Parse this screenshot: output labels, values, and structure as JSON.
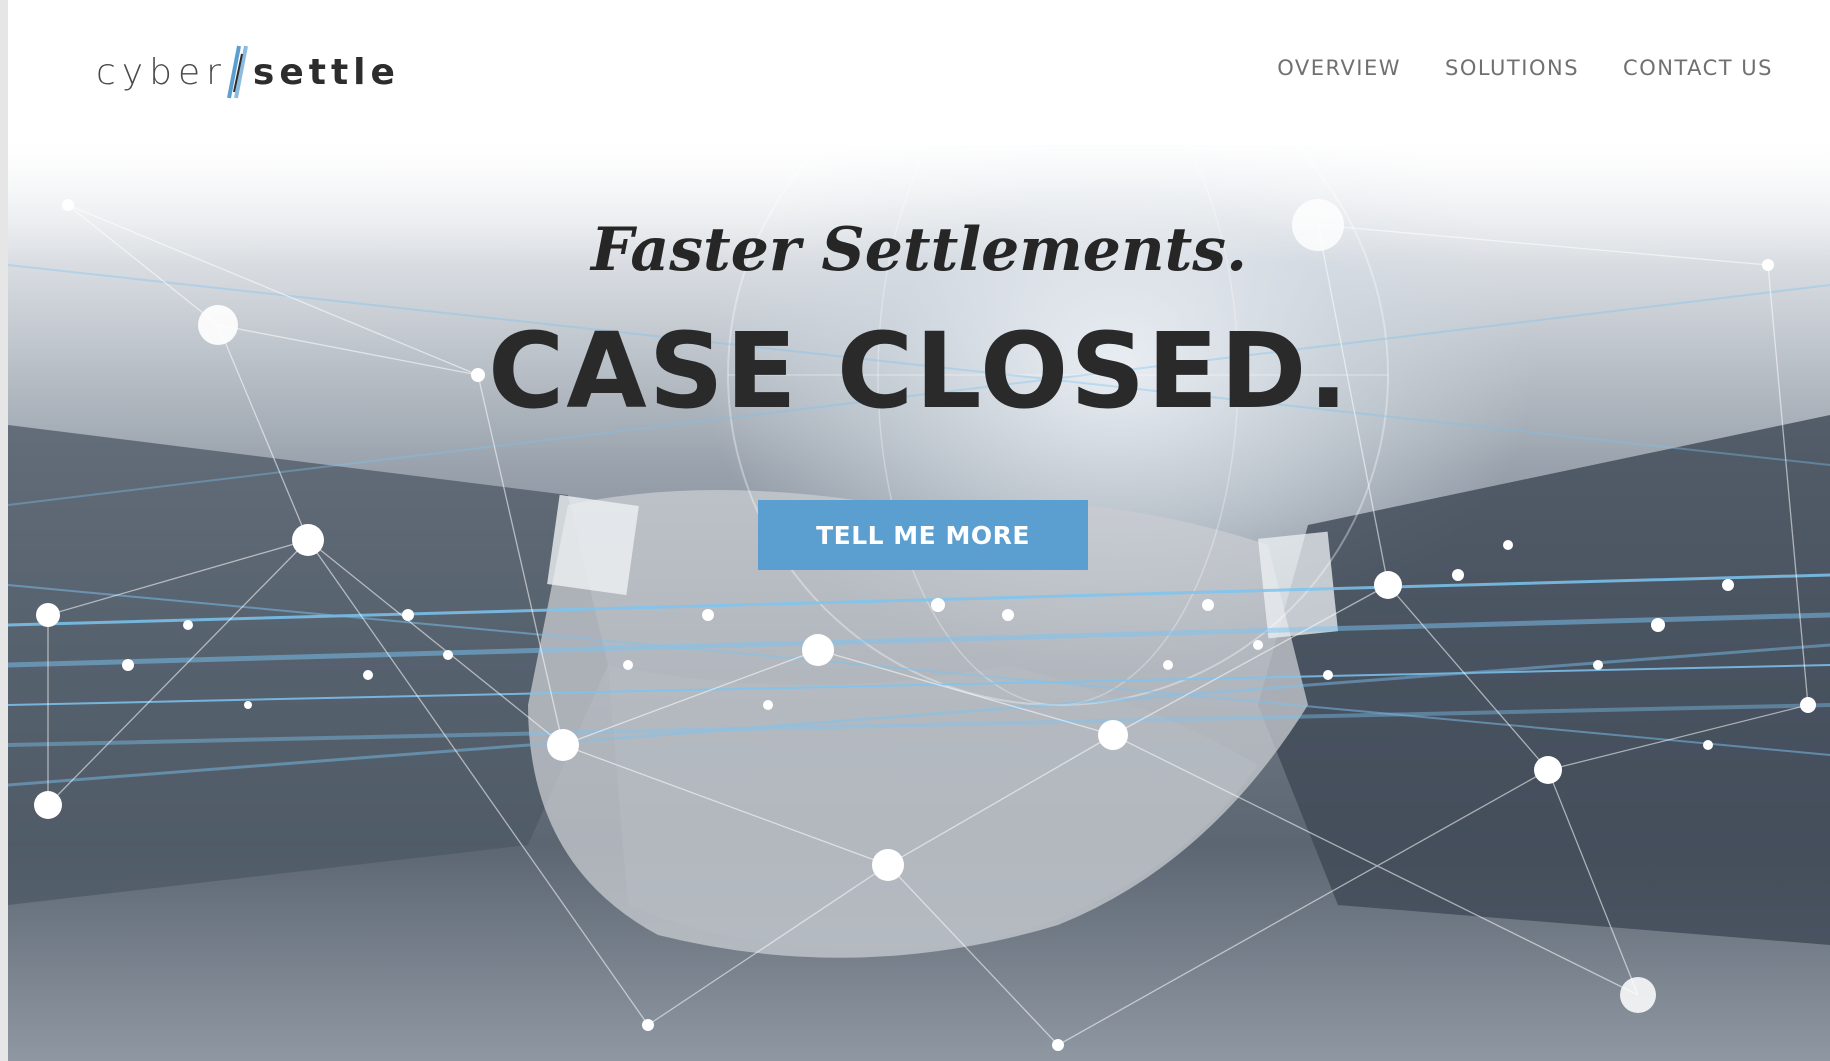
{
  "header": {
    "logo": {
      "part_a": "cyber",
      "part_b": "settle"
    },
    "nav": [
      {
        "label": "OVERVIEW"
      },
      {
        "label": "SOLUTIONS"
      },
      {
        "label": "CONTACT US"
      }
    ]
  },
  "hero": {
    "tagline": "Faster Settlements.",
    "headline": "CASE CLOSED.",
    "cta_label": "TELL ME MORE",
    "background_image": "handshake-network-image"
  },
  "colors": {
    "accent": "#5b9fd1",
    "headline": "#2a2a2a",
    "nav_text": "#707070"
  }
}
